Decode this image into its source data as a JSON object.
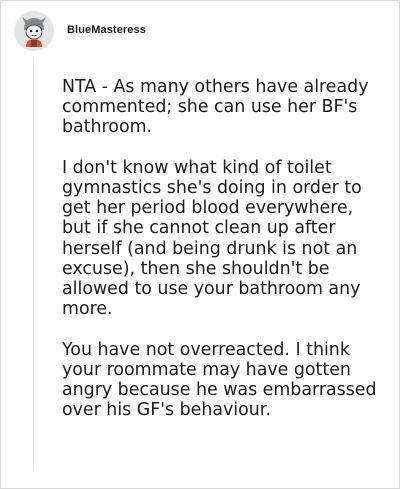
{
  "comment": {
    "username": "BlueMasteress",
    "avatar_icon": "snoo-avatar-icon",
    "paragraphs": [
      "NTA - As many others have already commented; she can use her BF's bathroom.",
      "I don't know what kind of toilet gymnastics she's doing in order to get her period blood everywhere, but if she cannot clean up after herself (and being drunk is not an excuse), then she shouldn't be allowed to use your bathroom any more.",
      "You have not overreacted. I think your roommate may have gotten angry because he was embarrassed over his GF's behaviour."
    ]
  },
  "colors": {
    "background": "#ffffff",
    "text": "#1c1c1c",
    "border": "#d9d9d9"
  }
}
